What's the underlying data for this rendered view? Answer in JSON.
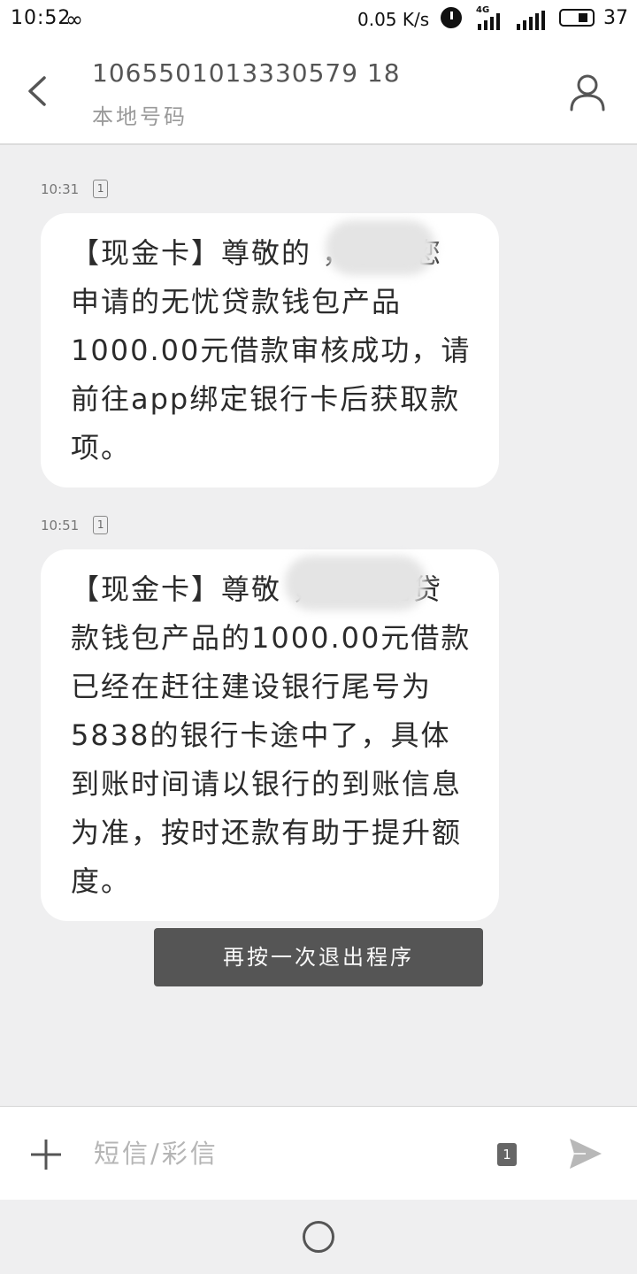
{
  "status_bar": {
    "time": "10:52",
    "infinity_icon": "∞",
    "net_speed": "0.05 K/s",
    "network_type": "4G",
    "battery_level": "37"
  },
  "header": {
    "phone_number": "1065501013330579 18",
    "subtitle": "本地号码"
  },
  "messages": [
    {
      "time": "10:31",
      "sim": "1",
      "text": "【现金卡】尊敬的 ，恭喜您申请的无忧贷款钱包产品1000.00元借款审核成功，请前往app绑定银行卡后获取款项。"
    },
    {
      "time": "10:51",
      "sim": "1",
      "text": "【现金卡】尊敬 ，您无忧贷款钱包产品的1000.00元借款已经在赶往建设银行尾号为5838的银行卡途中了，具体到账时间请以银行的到账信息为准，按时还款有助于提升额度。"
    }
  ],
  "toast": {
    "text": "再按一次退出程序"
  },
  "compose": {
    "placeholder": "短信/彩信",
    "sim_label": "1"
  },
  "icons": {
    "back": "chevron-left-icon",
    "profile": "person-icon",
    "add": "plus-icon",
    "send": "send-icon",
    "home": "home-circle-icon"
  }
}
